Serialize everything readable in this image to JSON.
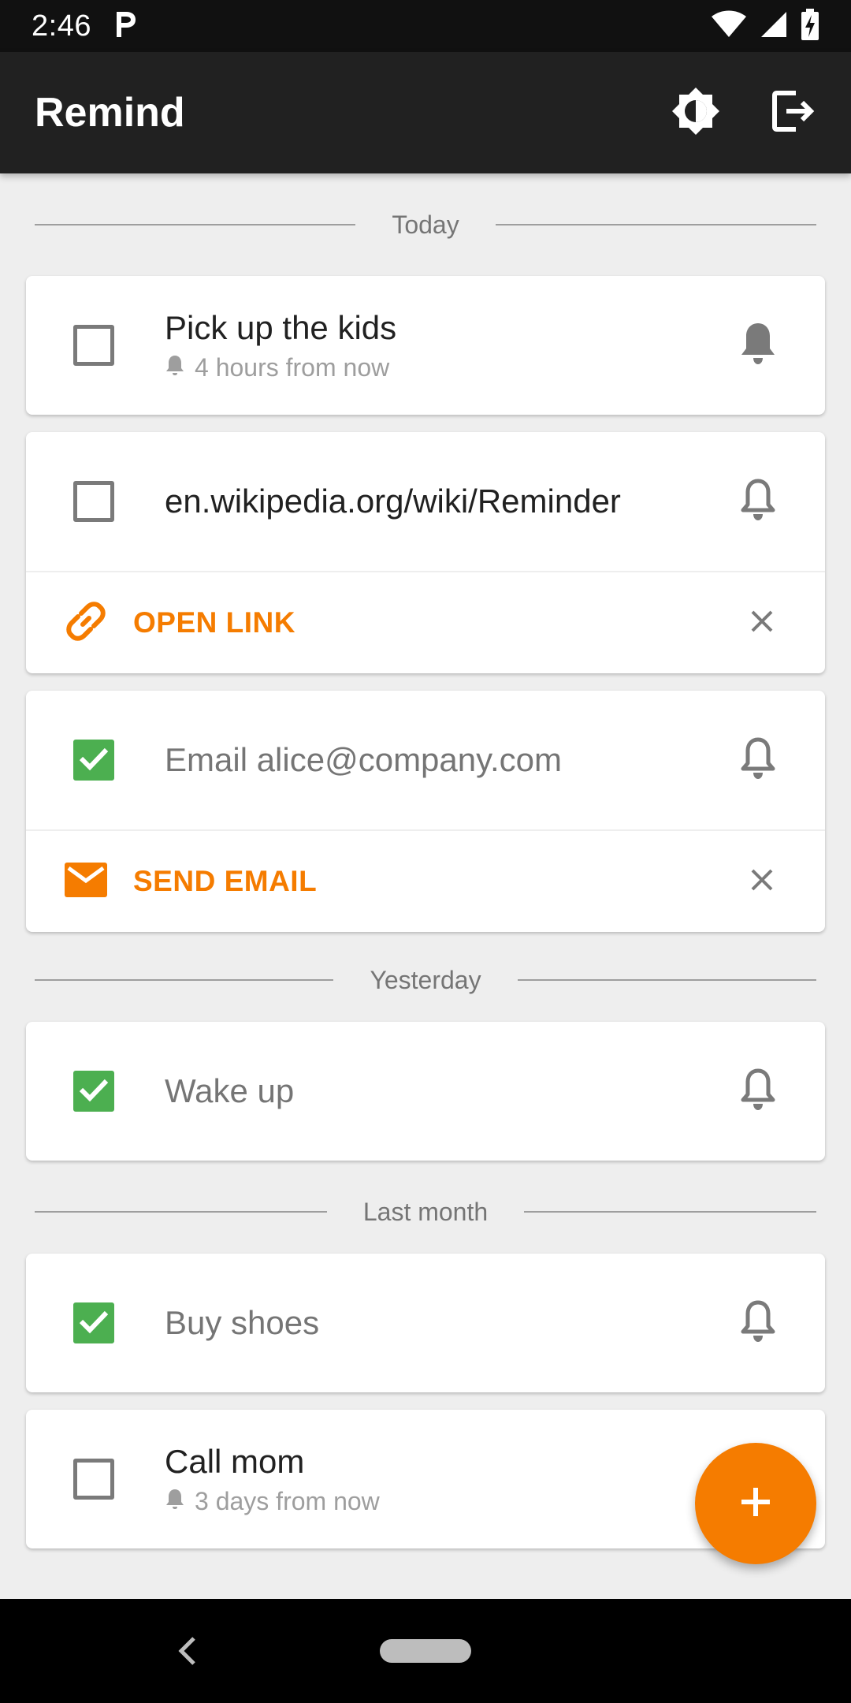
{
  "status_bar": {
    "time": "2:46",
    "icons": [
      "parking-icon",
      "wifi-icon",
      "signal-icon",
      "battery-icon"
    ]
  },
  "app_bar": {
    "title": "Remind",
    "actions": [
      "brightness-icon",
      "logout-icon"
    ]
  },
  "sections": {
    "today": "Today",
    "yesterday": "Yesterday",
    "last_month": "Last month"
  },
  "reminders": [
    {
      "title": "Pick up the kids",
      "subtitle": "4 hours from now",
      "checked": false,
      "bell": "filled"
    },
    {
      "title": "en.wikipedia.org/wiki/Reminder",
      "checked": false,
      "bell": "outline",
      "action_label": "OPEN LINK"
    },
    {
      "title": "Email alice@company.com",
      "checked": true,
      "bell": "outline",
      "action_label": "SEND EMAIL"
    },
    {
      "title": "Wake up",
      "checked": true,
      "bell": "outline"
    },
    {
      "title": "Buy shoes",
      "checked": true,
      "bell": "outline"
    },
    {
      "title": "Call mom",
      "subtitle": "3 days from now",
      "checked": false
    }
  ],
  "colors": {
    "accent": "#f57c00",
    "check": "#4caf50",
    "app_bar": "#212121",
    "background": "#eeeeee"
  },
  "fab": {
    "icon": "plus-icon"
  }
}
